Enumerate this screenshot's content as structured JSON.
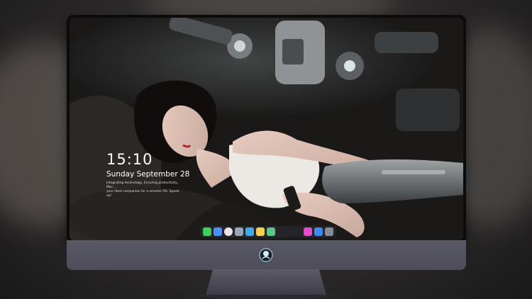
{
  "lock_screen": {
    "time": "15:10",
    "date": "Sunday September 28",
    "tagline_line1": "Integrating technology, Ensuring productivity, Mac...",
    "tagline_line2": "your ideal companion for a smarter life, Speed up!"
  },
  "dock": {
    "apps": [
      {
        "icon": "messages-icon",
        "color": "#3fcf5b"
      },
      {
        "icon": "finder-icon",
        "color": "#4d8ef7"
      },
      {
        "icon": "clock-icon",
        "color": "#e8e8e8"
      },
      {
        "icon": "preview-icon",
        "color": "#9aa6b4"
      },
      {
        "icon": "clapper-icon",
        "color": "#45a9e6"
      },
      {
        "icon": "notes-icon",
        "color": "#f5d04a"
      },
      {
        "icon": "photos-icon",
        "color": "#5cc58a"
      },
      {
        "icon": "music-icon",
        "color": "#e24ccf"
      },
      {
        "icon": "app-store-icon",
        "color": "#3b8cf2"
      },
      {
        "icon": "camera-icon",
        "color": "#8a8a94"
      }
    ]
  },
  "colors": {
    "bezel": "#0b0b0c",
    "chin": "#55545f",
    "background": "#2c2a2a"
  }
}
